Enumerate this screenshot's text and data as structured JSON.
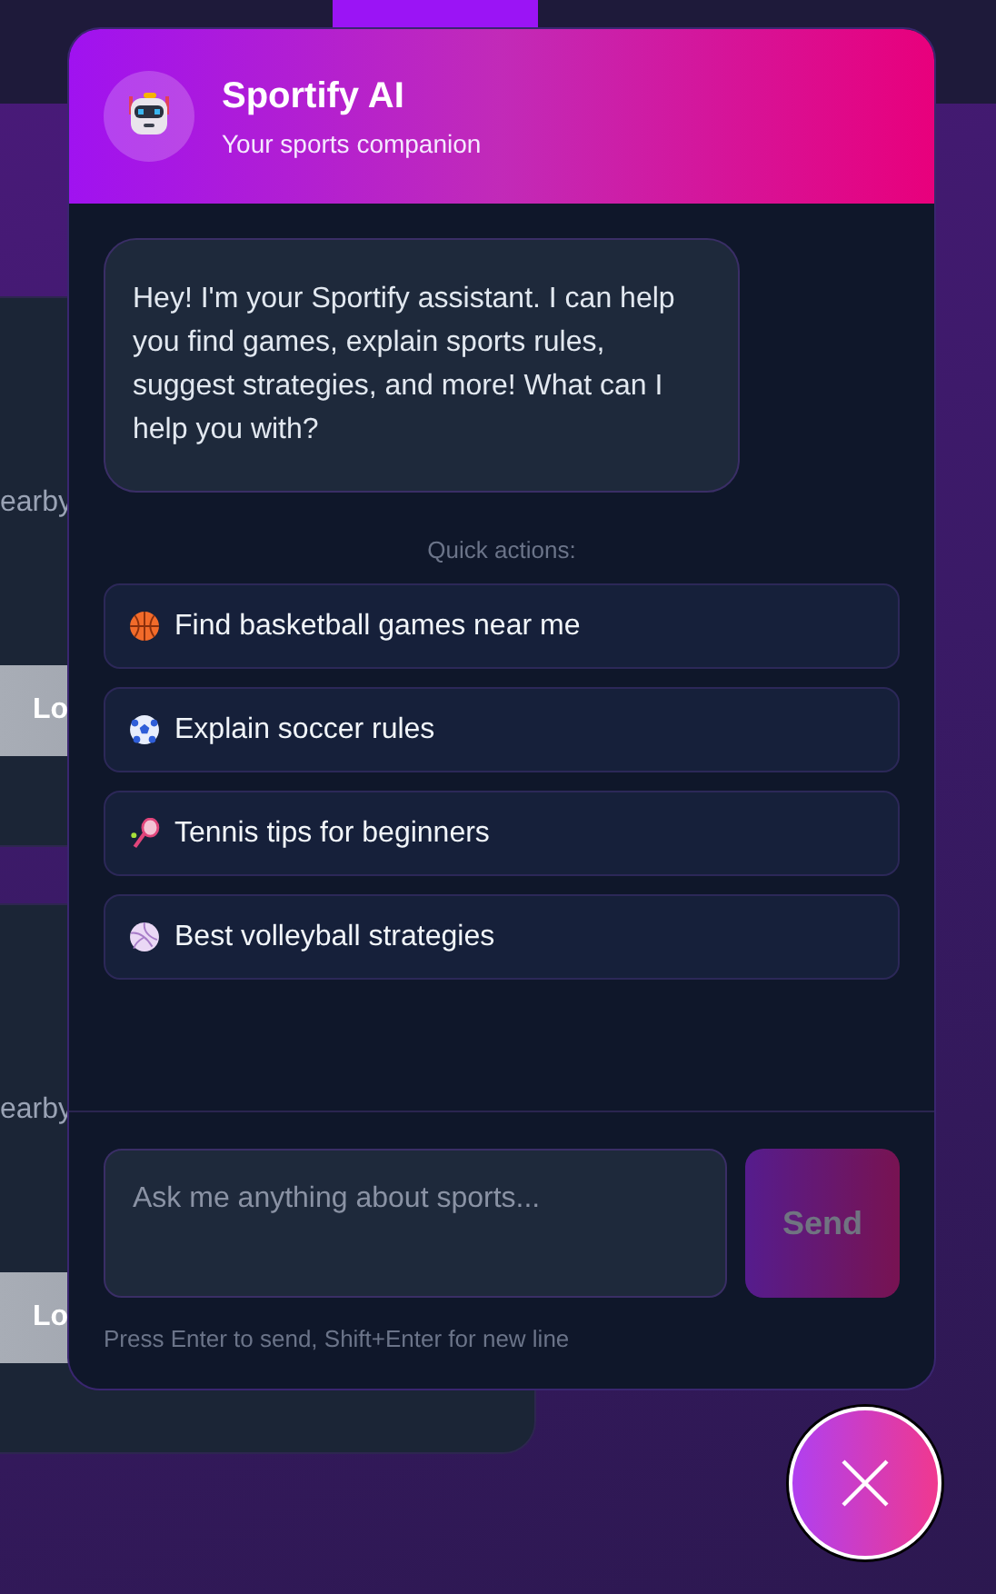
{
  "background_cards": [
    {
      "text": "earby",
      "button": "Lo"
    },
    {
      "text": "earby",
      "button": "Lo"
    }
  ],
  "chat": {
    "title": "Sportify AI",
    "subtitle": "Your sports companion",
    "message": "Hey! I'm your Sportify assistant. I can help you find games, explain sports rules, suggest strategies, and more! What can I help you with?",
    "quick_actions_label": "Quick actions:",
    "quick_actions": [
      {
        "kind": "basketball",
        "label": "Find basketball games near me"
      },
      {
        "kind": "soccer",
        "label": "Explain soccer rules"
      },
      {
        "kind": "tennis",
        "label": "Tennis tips for beginners"
      },
      {
        "kind": "volleyball",
        "label": "Best volleyball strategies"
      }
    ],
    "input": {
      "placeholder": "Ask me anything about sports..."
    },
    "send_button": {
      "label": "Send",
      "disabled": true
    },
    "hint": "Press Enter to send, Shift+Enter for new line"
  }
}
